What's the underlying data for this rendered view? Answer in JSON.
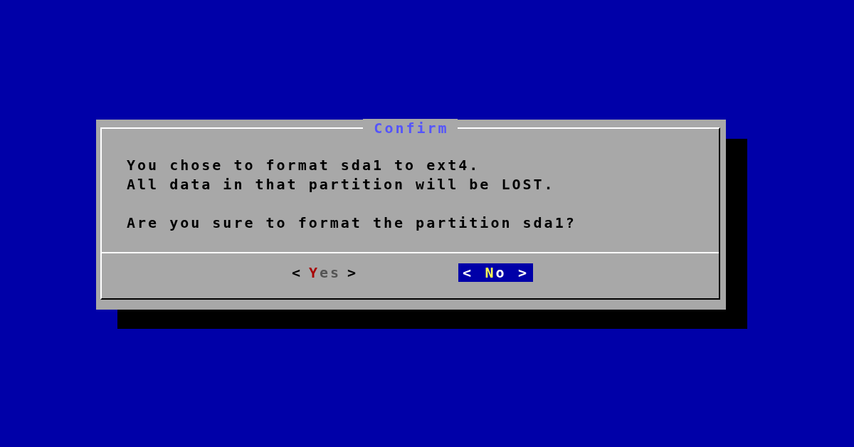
{
  "dialog": {
    "title": "Confirm",
    "message": [
      {
        "kind": "line",
        "text": "You chose to format sda1 to ext4."
      },
      {
        "kind": "line",
        "text": "All data in that partition will be LOST."
      },
      {
        "kind": "blank"
      },
      {
        "kind": "line",
        "text": "Are you sure to format the partition sda1?"
      }
    ],
    "buttons": [
      {
        "left": "<",
        "hotkey": "Y",
        "rest": "es",
        "right": ">",
        "selected": false
      },
      {
        "left": "<",
        "hotkey": "N",
        "rest": "o",
        "right": ">",
        "selected": true
      }
    ]
  }
}
